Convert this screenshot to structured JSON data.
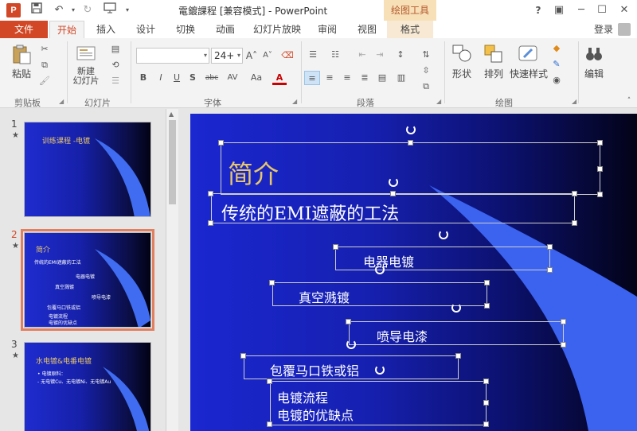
{
  "titlebar": {
    "app_icon": "P",
    "title": "電鍍課程 [兼容模式] - PowerPoint",
    "context_tab": "绘图工具",
    "window_buttons": [
      "?",
      "▣",
      "─",
      "☐",
      "✕"
    ]
  },
  "tabs": {
    "file": "文件",
    "items": [
      "开始",
      "插入",
      "设计",
      "切换",
      "动画",
      "幻灯片放映",
      "审阅",
      "视图",
      "格式"
    ],
    "active": "开始",
    "login": "登录"
  },
  "ribbon": {
    "clipboard": {
      "paste": "粘贴",
      "label": "剪贴板"
    },
    "slides": {
      "new_slide": "新建\n幻灯片",
      "label": "幻灯片"
    },
    "font": {
      "font_name": "",
      "font_size": "24+",
      "buttons": [
        "B",
        "I",
        "U",
        "S",
        "abc",
        "AV",
        "Aa",
        "A"
      ],
      "grow": "A˄",
      "shrink": "A˅",
      "label": "字体"
    },
    "paragraph": {
      "label": "段落"
    },
    "drawing": {
      "shapes": "形状",
      "arrange": "排列",
      "quick_styles": "快速样式",
      "label": "绘图"
    },
    "editing": {
      "edit": "编辑"
    }
  },
  "thumbnails": [
    {
      "num": "1",
      "title": "训练课程 -电镀",
      "lines": []
    },
    {
      "num": "2",
      "title": "简介",
      "lines": [
        "传统的EMI遮蔽的工法",
        "电器电镀",
        "真空溅镀",
        "喷导电漆",
        "包覆马口铁或铝",
        "电镀流程",
        "电镀的优缺点"
      ]
    },
    {
      "num": "3",
      "title": "水电镀&电番电镀",
      "lines": [
        "• 电镀原料：",
        "  - 无电镀Cu、无电镀Ni、无电镀Au"
      ]
    }
  ],
  "slide": {
    "title": "简介",
    "subtitle": "传统的EMI遮蔽的工法",
    "items": [
      "电器电镀",
      "真空溅镀",
      "喷导电漆",
      "包覆马口铁或铝"
    ],
    "bottom_lines": [
      "电镀流程",
      "电镀的优缺点"
    ]
  },
  "colors": {
    "accent": "#d24726",
    "title_gold": "#e8c76a",
    "slide_blue": "#1b27d0"
  }
}
